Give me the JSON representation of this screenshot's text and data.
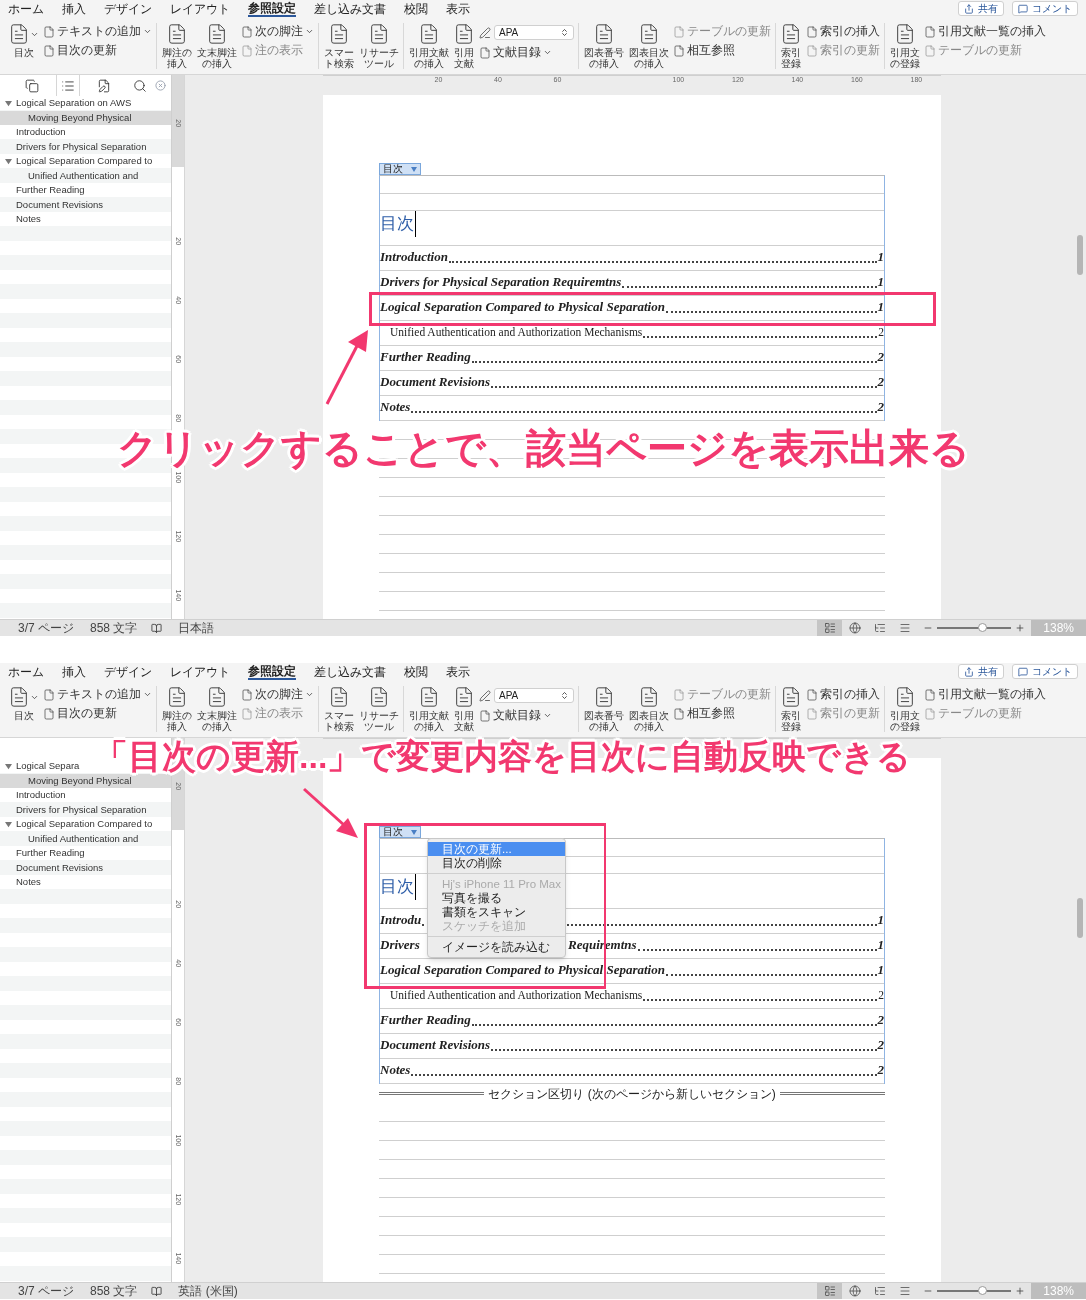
{
  "panels": [
    {
      "kind": "toc-entry",
      "menu_tabs": [
        {
          "label": "ホーム",
          "selected": false
        },
        {
          "label": "挿入",
          "selected": false
        },
        {
          "label": "デザイン",
          "selected": false
        },
        {
          "label": "レイアウト",
          "selected": false
        },
        {
          "label": "参照設定",
          "selected": true
        },
        {
          "label": "差し込み文書",
          "selected": false
        },
        {
          "label": "校閲",
          "selected": false
        },
        {
          "label": "表示",
          "selected": false
        }
      ],
      "share": "共有",
      "comment": "コメント",
      "ribbon": [
        {
          "items": [
            {
              "kind": "large",
              "label": "目次",
              "dropdown": true
            },
            {
              "kind": "small",
              "label": "テキストの追加",
              "dropdown": true,
              "disabled": false
            },
            {
              "kind": "small",
              "label": "目次の更新",
              "dropdown": false,
              "disabled": false
            }
          ]
        },
        {
          "items": [
            {
              "kind": "large",
              "label": "脚注の挿入",
              "dropdown": false
            },
            {
              "kind": "large",
              "label": "文末脚注の挿入",
              "dropdown": false
            },
            {
              "kind": "small",
              "label": "次の脚注",
              "dropdown": true,
              "disabled": false
            },
            {
              "kind": "small",
              "label": "注の表示",
              "dropdown": false,
              "disabled": true
            }
          ]
        },
        {
          "items": [
            {
              "kind": "large",
              "label": "スマート検索",
              "dropdown": false
            },
            {
              "kind": "large",
              "label": "リサーチツール",
              "dropdown": false
            }
          ]
        },
        {
          "items": [
            {
              "kind": "large",
              "label": "引用文献の挿入",
              "dropdown": false
            },
            {
              "kind": "large",
              "label": "引用文献",
              "dropdown": false
            },
            {
              "kind": "field",
              "value": "APA"
            },
            {
              "kind": "small",
              "label": "文献目録",
              "dropdown": true,
              "disabled": false
            }
          ]
        },
        {
          "items": [
            {
              "kind": "large",
              "label": "図表番号の挿入",
              "dropdown": false
            },
            {
              "kind": "large",
              "label": "図表目次の挿入",
              "dropdown": false
            },
            {
              "kind": "small",
              "label": "テーブルの更新",
              "dropdown": false,
              "disabled": true
            },
            {
              "kind": "small",
              "label": "相互参照",
              "dropdown": false,
              "disabled": false
            }
          ]
        },
        {
          "items": [
            {
              "kind": "large",
              "label": "索引登録",
              "dropdown": false
            },
            {
              "kind": "small",
              "label": "索引の挿入",
              "dropdown": false,
              "disabled": false
            },
            {
              "kind": "small",
              "label": "索引の更新",
              "dropdown": false,
              "disabled": true
            }
          ]
        },
        {
          "items": [
            {
              "kind": "large",
              "label": "引用文の登録",
              "dropdown": false
            },
            {
              "kind": "small",
              "label": "引用文献一覧の挿入",
              "dropdown": false,
              "disabled": false
            },
            {
              "kind": "small",
              "label": "テーブルの更新",
              "dropdown": false,
              "disabled": true
            }
          ]
        }
      ],
      "sidebar": {
        "tabs": [
          {
            "kind": "pages",
            "selected": false
          },
          {
            "kind": "outline",
            "selected": true
          },
          {
            "kind": "review",
            "selected": false
          },
          {
            "kind": "search",
            "selected": false
          }
        ],
        "items": [
          {
            "label": "Logical Separation on AWS",
            "selected": false,
            "expanded": true,
            "children": [
              {
                "label": "Moving Beyond Physical",
                "selected": true
              }
            ]
          },
          {
            "label": "Introduction",
            "selected": false
          },
          {
            "label": "Drivers for Physical Separation",
            "selected": false
          },
          {
            "label": "Logical Separation Compared to",
            "selected": false,
            "expanded": true,
            "children": [
              {
                "label": "Unified Authentication and",
                "selected": false
              }
            ]
          },
          {
            "label": "Further Reading",
            "selected": false
          },
          {
            "label": "Document Revisions",
            "selected": false
          },
          {
            "label": "Notes",
            "selected": false
          }
        ]
      },
      "ruler": [
        "20",
        "40",
        "60",
        "100",
        "120",
        "140",
        "160",
        "180"
      ],
      "vertical_ruler": [
        "20",
        "20",
        "40",
        "60",
        "80",
        "100",
        "120",
        "140"
      ],
      "page": {
        "toc_tag": "目次",
        "heading": "目次",
        "entries": [
          {
            "title": "Introduction",
            "page": "1"
          },
          {
            "title": "Drivers for Physical Separation Requiremtns",
            "page": "1"
          },
          {
            "title": "Logical Separation Compared to Physical Separation",
            "page": "1",
            "children": [
              {
                "title": "Unified Authentication and Authorization Mechanisms",
                "page": "2"
              }
            ]
          },
          {
            "title": "Further Reading",
            "page": "2"
          },
          {
            "title": "Document Revisions",
            "page": "2"
          },
          {
            "title": "Notes",
            "page": "2"
          }
        ]
      },
      "status": {
        "page": "3/7 ページ",
        "words": "858 文字",
        "language": "日本語",
        "views": [
          {
            "kind": "print",
            "selected": true
          },
          {
            "kind": "web",
            "selected": false
          },
          {
            "kind": "outline",
            "selected": false
          },
          {
            "kind": "draft",
            "selected": false
          }
        ],
        "zoom": {
          "level": 0.6
        },
        "zoom_text": "138%"
      },
      "caption": "クリックすることで、該当ページを表示出来る"
    },
    {
      "kind": "menu",
      "menu_tabs": [
        {
          "label": "ホーム",
          "selected": false
        },
        {
          "label": "挿入",
          "selected": false
        },
        {
          "label": "デザイン",
          "selected": false
        },
        {
          "label": "レイアウト",
          "selected": false
        },
        {
          "label": "参照設定",
          "selected": true
        },
        {
          "label": "差し込み文書",
          "selected": false
        },
        {
          "label": "校閲",
          "selected": false
        },
        {
          "label": "表示",
          "selected": false
        }
      ],
      "share": "共有",
      "comment": "コメント",
      "ribbon": [
        {
          "items": [
            {
              "kind": "large",
              "label": "目次",
              "dropdown": true
            },
            {
              "kind": "small",
              "label": "テキストの追加",
              "dropdown": true,
              "disabled": false
            },
            {
              "kind": "small",
              "label": "目次の更新",
              "dropdown": false,
              "disabled": false
            }
          ]
        },
        {
          "items": [
            {
              "kind": "large",
              "label": "脚注の挿入",
              "dropdown": false
            },
            {
              "kind": "large",
              "label": "文末脚注の挿入",
              "dropdown": false
            },
            {
              "kind": "small",
              "label": "次の脚注",
              "dropdown": true,
              "disabled": false
            },
            {
              "kind": "small",
              "label": "注の表示",
              "dropdown": false,
              "disabled": true
            }
          ]
        },
        {
          "items": [
            {
              "kind": "large",
              "label": "スマート検索",
              "dropdown": false
            },
            {
              "kind": "large",
              "label": "リサーチツール",
              "dropdown": false
            }
          ]
        },
        {
          "items": [
            {
              "kind": "large",
              "label": "引用文献の挿入",
              "dropdown": false
            },
            {
              "kind": "large",
              "label": "引用文献",
              "dropdown": false
            },
            {
              "kind": "field",
              "value": "APA"
            },
            {
              "kind": "small",
              "label": "文献目録",
              "dropdown": true,
              "disabled": false
            }
          ]
        },
        {
          "items": [
            {
              "kind": "large",
              "label": "図表番号の挿入",
              "dropdown": false
            },
            {
              "kind": "large",
              "label": "図表目次の挿入",
              "dropdown": false
            },
            {
              "kind": "small",
              "label": "テーブルの更新",
              "dropdown": false,
              "disabled": true
            },
            {
              "kind": "small",
              "label": "相互参照",
              "dropdown": false,
              "disabled": false
            }
          ]
        },
        {
          "items": [
            {
              "kind": "large",
              "label": "索引登録",
              "dropdown": false
            },
            {
              "kind": "small",
              "label": "索引の挿入",
              "dropdown": false,
              "disabled": false
            },
            {
              "kind": "small",
              "label": "索引の更新",
              "dropdown": false,
              "disabled": true
            }
          ]
        },
        {
          "items": [
            {
              "kind": "large",
              "label": "引用文の登録",
              "dropdown": false
            },
            {
              "kind": "small",
              "label": "引用文献一覧の挿入",
              "dropdown": false,
              "disabled": false
            },
            {
              "kind": "small",
              "label": "テーブルの更新",
              "dropdown": false,
              "disabled": true
            }
          ]
        }
      ],
      "sidebar": {
        "items": [
          {
            "label": "Logical Separa",
            "selected": false,
            "expanded": true,
            "children": [
              {
                "label": "Moving Beyond Physical",
                "selected": true
              }
            ]
          },
          {
            "label": "Introduction",
            "selected": false
          },
          {
            "label": "Drivers for Physical Separation",
            "selected": false
          },
          {
            "label": "Logical Separation Compared to",
            "selected": false,
            "expanded": true,
            "children": [
              {
                "label": "Unified Authentication and",
                "selected": false
              }
            ]
          },
          {
            "label": "Further Reading",
            "selected": false
          },
          {
            "label": "Document Revisions",
            "selected": false
          },
          {
            "label": "Notes",
            "selected": false
          }
        ]
      },
      "vertical_ruler": [
        "20",
        "20",
        "40",
        "60",
        "80",
        "100",
        "120",
        "140"
      ],
      "page": {
        "toc_tag": "目次",
        "heading": "目次",
        "entries": [
          {
            "title": "Introdu",
            "page": "1"
          },
          {
            "title": "Drivers",
            "title_tail": "Requiremtns",
            "page": "1"
          },
          {
            "title": "Logical Separation Compared to Physical Separation",
            "page": "1",
            "children": [
              {
                "title": "Unified Authentication and Authorization Mechanisms",
                "page": "2"
              }
            ]
          },
          {
            "title": "Further Reading",
            "page": "2"
          },
          {
            "title": "Document Revisions",
            "page": "2"
          },
          {
            "title": "Notes",
            "page": "2"
          }
        ],
        "section_break": "セクション区切り (次のページから新しいセクション)",
        "context_menu": [
          {
            "kind": "item",
            "label": "目次の更新...",
            "selected": true,
            "disabled": false
          },
          {
            "kind": "item",
            "label": "目次の削除",
            "selected": false,
            "disabled": false
          },
          {
            "kind": "separator"
          },
          {
            "kind": "item",
            "label": "Hj's iPhone 11 Pro Max",
            "selected": false,
            "disabled": true
          },
          {
            "kind": "item",
            "label": "写真を撮る",
            "selected": false,
            "disabled": false
          },
          {
            "kind": "item",
            "label": "書類をスキャン",
            "selected": false,
            "disabled": false
          },
          {
            "kind": "item",
            "label": "スケッチを追加",
            "selected": false,
            "disabled": true
          },
          {
            "kind": "separator"
          },
          {
            "kind": "item",
            "label": "イメージを読み込む",
            "selected": false,
            "disabled": false
          }
        ]
      },
      "status": {
        "page": "3/7 ページ",
        "words": "858 文字",
        "language": "英語 (米国)",
        "views": [
          {
            "kind": "print",
            "selected": true
          },
          {
            "kind": "web",
            "selected": false
          },
          {
            "kind": "outline",
            "selected": false
          },
          {
            "kind": "draft",
            "selected": false
          }
        ],
        "zoom": {
          "level": 0.6
        },
        "zoom_text": "138%"
      },
      "caption": "「目次の更新...」で変更内容を目次に自動反映できる"
    }
  ]
}
